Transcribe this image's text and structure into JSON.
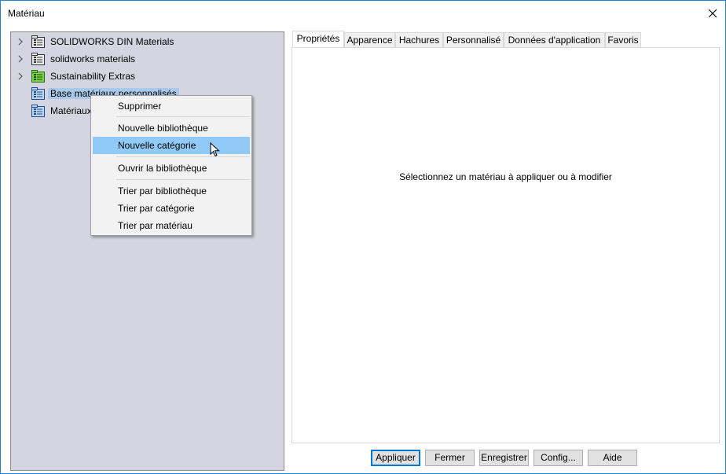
{
  "window": {
    "title": "Matériau"
  },
  "tree": {
    "items": [
      {
        "label": "SOLIDWORKS DIN Materials",
        "expandable": true,
        "icon": "library-icon"
      },
      {
        "label": "solidworks materials",
        "expandable": true,
        "icon": "library-icon"
      },
      {
        "label": "Sustainability Extras",
        "expandable": true,
        "icon": "green-library-icon"
      },
      {
        "label": "Base matériaux personnalisés",
        "expandable": false,
        "icon": "custom-library-icon"
      },
      {
        "label": "Matériaux",
        "expandable": false,
        "icon": "custom-library-icon"
      }
    ]
  },
  "context_menu": {
    "items": [
      {
        "label": "Supprimer"
      },
      {
        "label": "Nouvelle bibliothèque"
      },
      {
        "label": "Nouvelle catégorie"
      },
      {
        "label": "Ouvrir la bibliothèque"
      },
      {
        "label": "Trier par bibliothèque"
      },
      {
        "label": "Trier par catégorie"
      },
      {
        "label": "Trier par matériau"
      }
    ],
    "highlighted": "Nouvelle catégorie"
  },
  "tabs": [
    {
      "label": "Propriétés"
    },
    {
      "label": "Apparence"
    },
    {
      "label": "Hachures"
    },
    {
      "label": "Personnalisé"
    },
    {
      "label": "Données d'application"
    },
    {
      "label": "Favoris"
    }
  ],
  "content": {
    "hint": "Sélectionnez un matériau à appliquer ou à modifier"
  },
  "buttons": {
    "apply": "Appliquer",
    "close": "Fermer",
    "save": "Enregistrer",
    "config": "Config...",
    "help": "Aide"
  },
  "colors": {
    "accent": "#0078d7",
    "tree_bg": "#d4d5e1",
    "selection": "#a9c9ea",
    "menu_highlight": "#91c9f7"
  }
}
